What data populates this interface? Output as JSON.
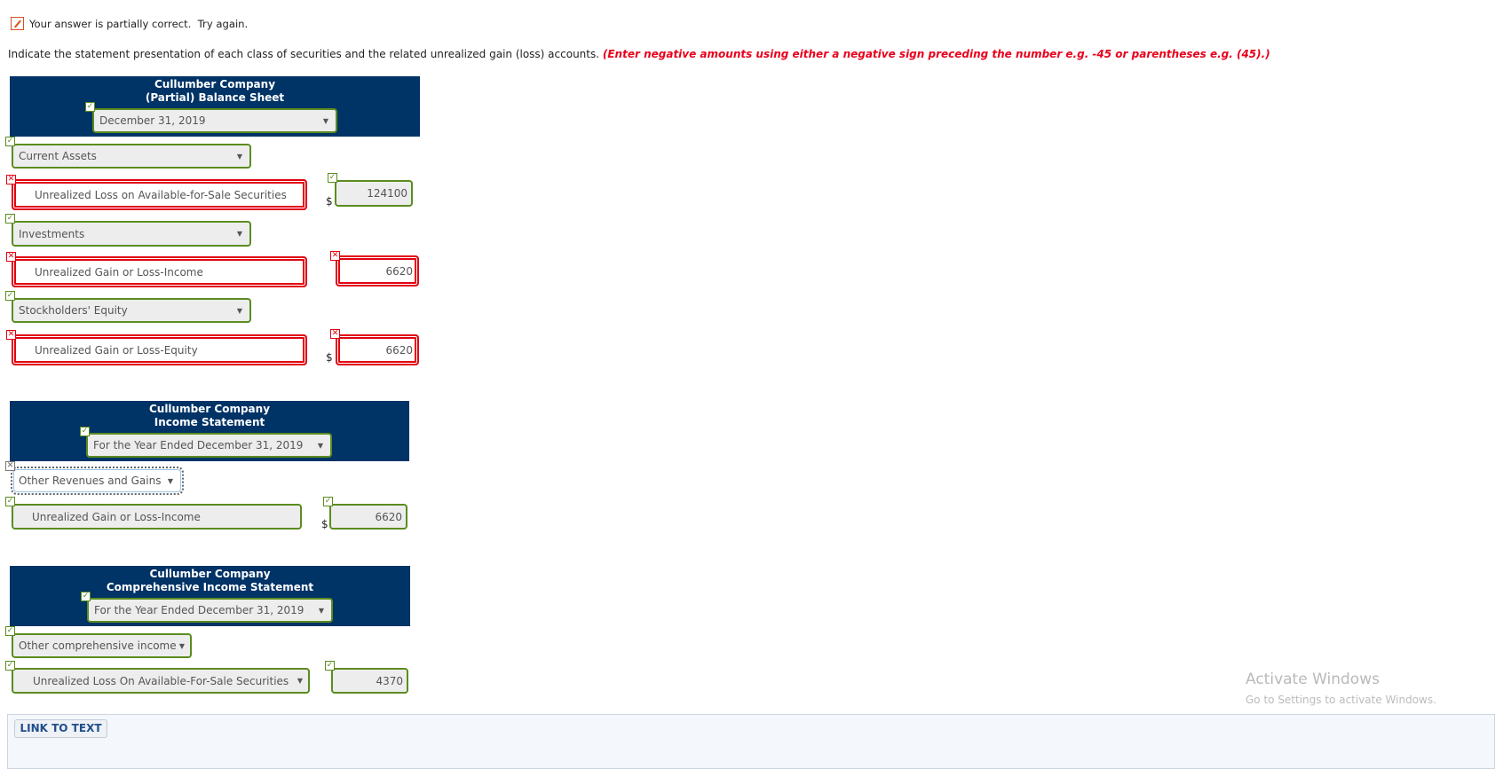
{
  "colors": {
    "header_bg": "#003366",
    "correct": "#5b8c1f",
    "incorrect": "#e1000f",
    "note": "#e8001c",
    "feedback_icon": "#d9531e",
    "link_text": "#1f4e8c"
  },
  "feedback": {
    "icon": "edit-icon",
    "message": "Your answer is partially correct.  Try again."
  },
  "instructions": {
    "text": "Indicate the statement presentation of each class of securities and the related unrealized gain (loss) accounts. ",
    "note": "(Enter negative amounts using either a negative sign preceding the number e.g. -45 or parentheses e.g. (45).)"
  },
  "balance_sheet": {
    "company": "Cullumber Company",
    "title": "(Partial) Balance Sheet",
    "date": {
      "value": "December 31, 2019",
      "status": "correct"
    },
    "sections": [
      {
        "heading": {
          "value": "Current Assets",
          "status": "correct"
        },
        "account": {
          "value": "Unrealized Loss on Available-for-Sale Securities",
          "status": "incorrect"
        },
        "amount": {
          "currency": "$",
          "value": "124100",
          "status": "correct"
        }
      },
      {
        "heading": {
          "value": "Investments",
          "status": "correct"
        },
        "account": {
          "value": "Unrealized Gain or Loss-Income",
          "status": "incorrect"
        },
        "amount": {
          "currency": "",
          "value": "6620",
          "status": "incorrect"
        }
      },
      {
        "heading": {
          "value": "Stockholders' Equity",
          "status": "correct"
        },
        "account": {
          "value": "Unrealized Gain or Loss-Equity",
          "status": "incorrect"
        },
        "amount": {
          "currency": "$",
          "value": "6620",
          "status": "incorrect"
        }
      }
    ]
  },
  "income_statement": {
    "company": "Cullumber Company",
    "title": "Income Statement",
    "date": {
      "value": "For the Year Ended December 31, 2019",
      "status": "correct"
    },
    "section": {
      "heading": {
        "value": "Other Revenues and Gains",
        "status": "incorrect",
        "focused": true
      },
      "account": {
        "value": "Unrealized Gain or Loss-Income",
        "status": "correct"
      },
      "amount": {
        "currency": "$",
        "value": "6620",
        "status": "correct"
      }
    }
  },
  "comprehensive_income_statement": {
    "company": "Cullumber Company",
    "title": "Comprehensive Income Statement",
    "date": {
      "value": "For the Year Ended December 31, 2019",
      "status": "correct"
    },
    "section": {
      "heading": {
        "value": "Other comprehensive income",
        "status": "correct"
      },
      "account": {
        "value": "Unrealized Loss On Available-For-Sale Securities",
        "status": "correct"
      },
      "amount": {
        "currency": "",
        "value": "4370",
        "status": "correct"
      }
    }
  },
  "footer": {
    "link_to_text_label": "LINK TO TEXT"
  },
  "watermark": {
    "title": "Activate Windows",
    "subtitle": "Go to Settings to activate Windows."
  },
  "icons": {
    "dropdown_arrow": "▼"
  }
}
